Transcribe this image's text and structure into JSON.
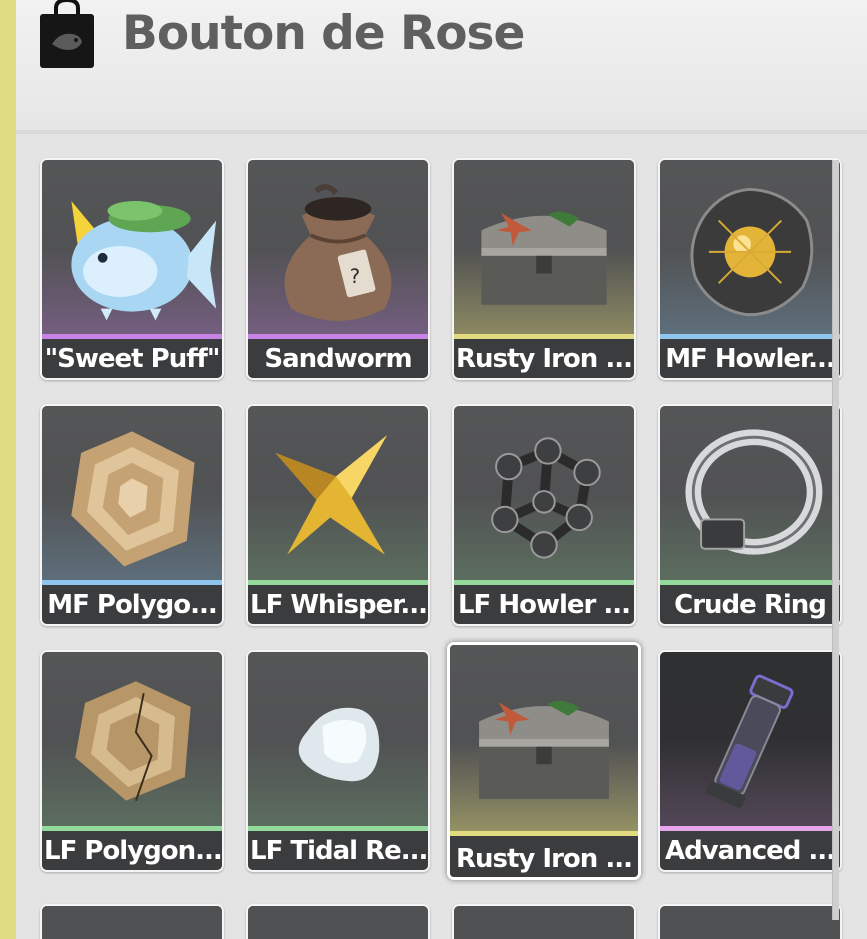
{
  "header": {
    "title": "Bouton de Rose",
    "icon": "shopping-bag-icon"
  },
  "colors": {
    "accent": "#e0dc83",
    "purple": "#c784e6",
    "blue": "#8fc6ee",
    "green": "#93d99b",
    "gold": "#e2da7f",
    "pink": "#e9a6ef"
  },
  "items": [
    {
      "name": "\"Sweet Puff\"",
      "icon": "pufferfish-icon",
      "rarity": "purple"
    },
    {
      "name": "Sandworm",
      "icon": "sack-icon",
      "rarity": "purple"
    },
    {
      "name": "Rusty Iron ...",
      "icon": "treasure-chest-icon",
      "rarity": "gold"
    },
    {
      "name": "MF Howler...",
      "icon": "gold-orb-core-icon",
      "rarity": "blue"
    },
    {
      "name": "MF Polygo...",
      "icon": "polygon-core-icon",
      "rarity": "blue"
    },
    {
      "name": "LF Whisper...",
      "icon": "gold-star-core-icon",
      "rarity": "green"
    },
    {
      "name": "LF Howler ...",
      "icon": "molecule-core-icon",
      "rarity": "green"
    },
    {
      "name": "Crude Ring",
      "icon": "ring-icon",
      "rarity": "green"
    },
    {
      "name": "LF Polygon...",
      "icon": "cracked-polygon-core-icon",
      "rarity": "green"
    },
    {
      "name": "LF Tidal Re...",
      "icon": "tidal-crystal-icon",
      "rarity": "green"
    },
    {
      "name": "Rusty Iron ...",
      "icon": "treasure-chest-icon",
      "rarity": "gold",
      "selected": true
    },
    {
      "name": "Advanced ...",
      "icon": "vial-icon",
      "rarity": "pink"
    }
  ]
}
